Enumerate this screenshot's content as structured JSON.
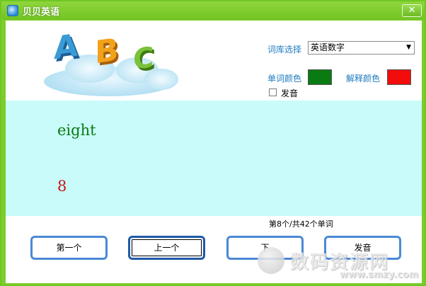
{
  "window": {
    "title": "贝贝英语",
    "close_glyph": "✕"
  },
  "logo": {
    "letters": [
      "A",
      "B",
      "C"
    ]
  },
  "settings": {
    "library_label": "词库选择",
    "library_value": "英语数字",
    "word_color_label": "单词颜色",
    "explain_color_label": "解释颜色",
    "word_color": "#0a7a12",
    "explain_color": "#f20c0c",
    "pronounce_label": "发音",
    "pronounce_checked": false
  },
  "display": {
    "word": "eight",
    "explanation": "8"
  },
  "counter": "第8个/共42个单词",
  "buttons": {
    "first": "第一个",
    "prev": "上一个",
    "next": "下",
    "speak": "发音"
  },
  "watermark": {
    "text": "数码资源网",
    "url": "www.smzy.com"
  },
  "icons": {
    "app": "globe-app-icon",
    "dropdown": "chevron-down-icon"
  }
}
